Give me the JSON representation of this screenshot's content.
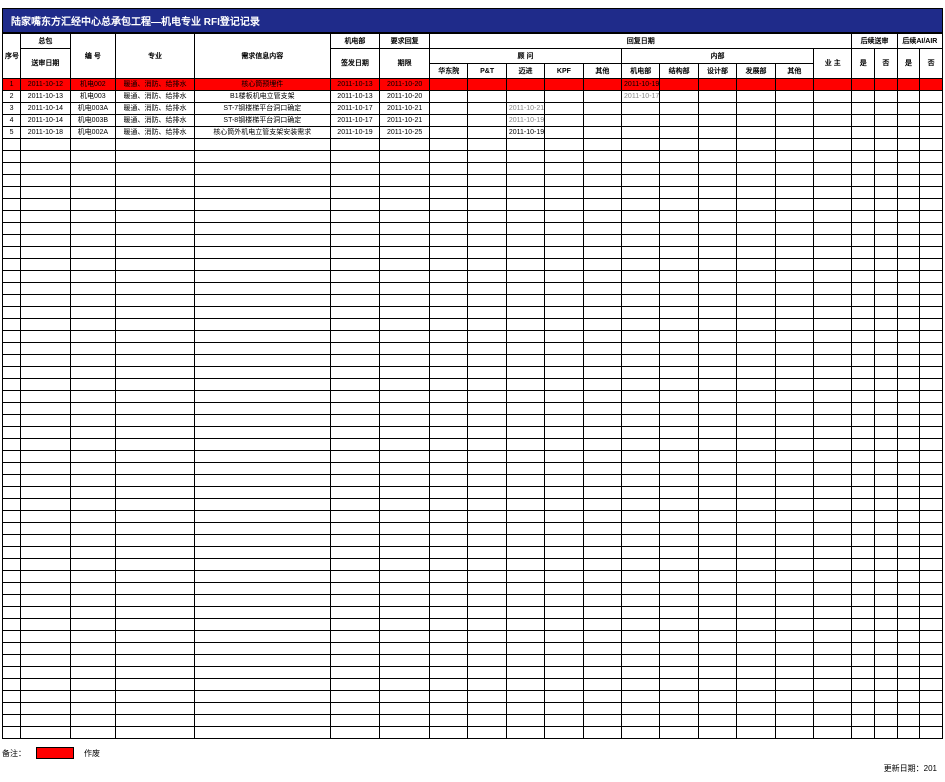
{
  "title": "陆家嘴东方汇经中心总承包工程—机电专业 RFI登记记录",
  "headers": {
    "seq": "序号",
    "general_contractor": "总包",
    "submit_date": "送审日期",
    "number": "编 号",
    "discipline": "专业",
    "request_content": "需求信息内容",
    "me_dept": "机电部",
    "issue_date": "签发日期",
    "require_reply": "要求回复",
    "deadline": "期限",
    "reply_date_group": "回复日期",
    "consultant_group": "顾 问",
    "consultant_hd": "华东院",
    "consultant_pt": "P&T",
    "consultant_mj": "迈进",
    "consultant_kpf": "KPF",
    "consultant_other": "其他",
    "internal_group": "内部",
    "internal_me": "机电部",
    "internal_struct": "结构部",
    "internal_design": "设计部",
    "internal_dev": "发展部",
    "internal_other": "其他",
    "owner": "业 主",
    "followup_return": "后续送审",
    "followup_air": "后续AI/AIR",
    "yes": "是",
    "no": "否"
  },
  "rows": [
    {
      "seq": "1",
      "submit_date": "2011-10-12",
      "number": "机电002",
      "discipline": "暖通、消防、给排水",
      "content": "核心筒预埋件",
      "issue_date": "2011-10-13",
      "deadline": "2011-10-20",
      "consultant_mj": "",
      "internal_me": "2011-10-19",
      "highlight": true
    },
    {
      "seq": "2",
      "submit_date": "2011-10-13",
      "number": "机电003",
      "discipline": "暖通、消防、给排水",
      "content": "B1楼板机电立管支架",
      "issue_date": "2011-10-13",
      "deadline": "2011-10-20",
      "consultant_mj": "",
      "internal_me": "2011-10-17",
      "internal_me_gray": true
    },
    {
      "seq": "3",
      "submit_date": "2011-10-14",
      "number": "机电003A",
      "discipline": "暖通、消防、给排水",
      "content": "ST-7钢楼梯平台洞口确定",
      "issue_date": "2011-10-17",
      "deadline": "2011-10-21",
      "consultant_mj": "2011-10-21",
      "consultant_mj_gray": true,
      "internal_me": ""
    },
    {
      "seq": "4",
      "submit_date": "2011-10-14",
      "number": "机电003B",
      "discipline": "暖通、消防、给排水",
      "content": "ST-8钢楼梯平台洞口确定",
      "issue_date": "2011-10-17",
      "deadline": "2011-10-21",
      "consultant_mj": "2011-10-19",
      "consultant_mj_gray": true,
      "internal_me": ""
    },
    {
      "seq": "5",
      "submit_date": "2011-10-18",
      "number": "机电002A",
      "discipline": "暖通、消防、给排水",
      "content": "核心筒外机电立管支架安装需求",
      "issue_date": "2011-10-19",
      "deadline": "2011-10-25",
      "consultant_mj": "2011-10-19",
      "internal_me": ""
    }
  ],
  "footer": {
    "note_label": "备注：",
    "swatch_label": "作废"
  },
  "update": {
    "label": "更新日期：",
    "value": "201"
  },
  "empty_row_count": 50
}
